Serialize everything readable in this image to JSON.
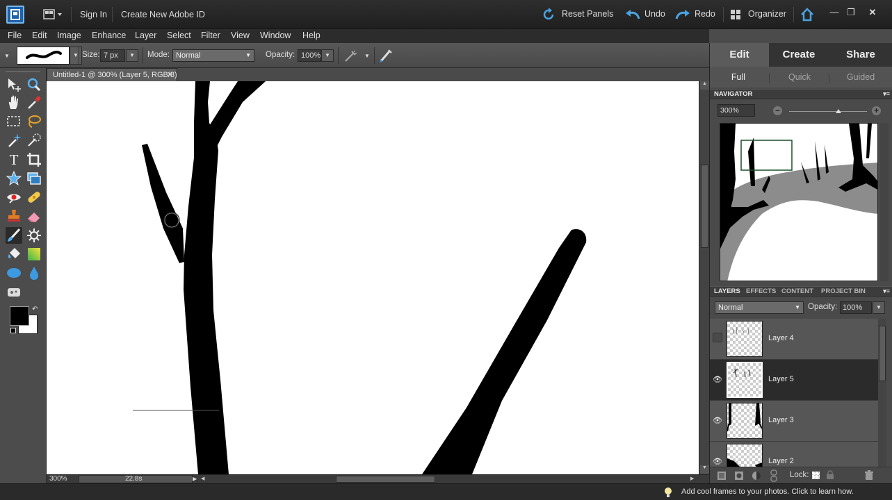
{
  "titlebar": {
    "sign_in": "Sign In",
    "create_id": "Create New Adobe ID",
    "reset_panels": "Reset Panels",
    "undo": "Undo",
    "redo": "Redo",
    "organizer": "Organizer"
  },
  "menu": [
    "File",
    "Edit",
    "Image",
    "Enhance",
    "Layer",
    "Select",
    "Filter",
    "View",
    "Window",
    "Help"
  ],
  "options": {
    "size_label": "Size:",
    "size_value": "7 px",
    "mode_label": "Mode:",
    "mode_value": "Normal",
    "opacity_label": "Opacity:",
    "opacity_value": "100%"
  },
  "document": {
    "tab_label": "Untitled-1 @ 300% (Layer 5, RGB/8) *",
    "zoom": "300%",
    "status": "22.8s"
  },
  "panel": {
    "modes": [
      "Edit",
      "Create",
      "Share"
    ],
    "subtabs": [
      "Full",
      "Quick",
      "Guided"
    ],
    "navigator_title": "NAVIGATOR",
    "navigator_zoom": "300%",
    "layers_tabs": [
      "LAYERS",
      "EFFECTS",
      "CONTENT",
      "PROJECT BIN"
    ],
    "blend_mode": "Normal",
    "opacity_label": "Opacity:",
    "opacity_value": "100%",
    "layers": [
      {
        "name": "Layer 4",
        "visible": false,
        "selected": false
      },
      {
        "name": "Layer 5",
        "visible": true,
        "selected": true
      },
      {
        "name": "Layer 3",
        "visible": true,
        "selected": false
      },
      {
        "name": "Layer 2",
        "visible": true,
        "selected": false
      }
    ],
    "lock_label": "Lock:"
  },
  "footer": {
    "tip": "Add cool frames to your photos. Click to learn how."
  },
  "colors": {
    "accent_blue": "#4aa3e0",
    "foreground": "#000000",
    "background": "#ffffff"
  }
}
